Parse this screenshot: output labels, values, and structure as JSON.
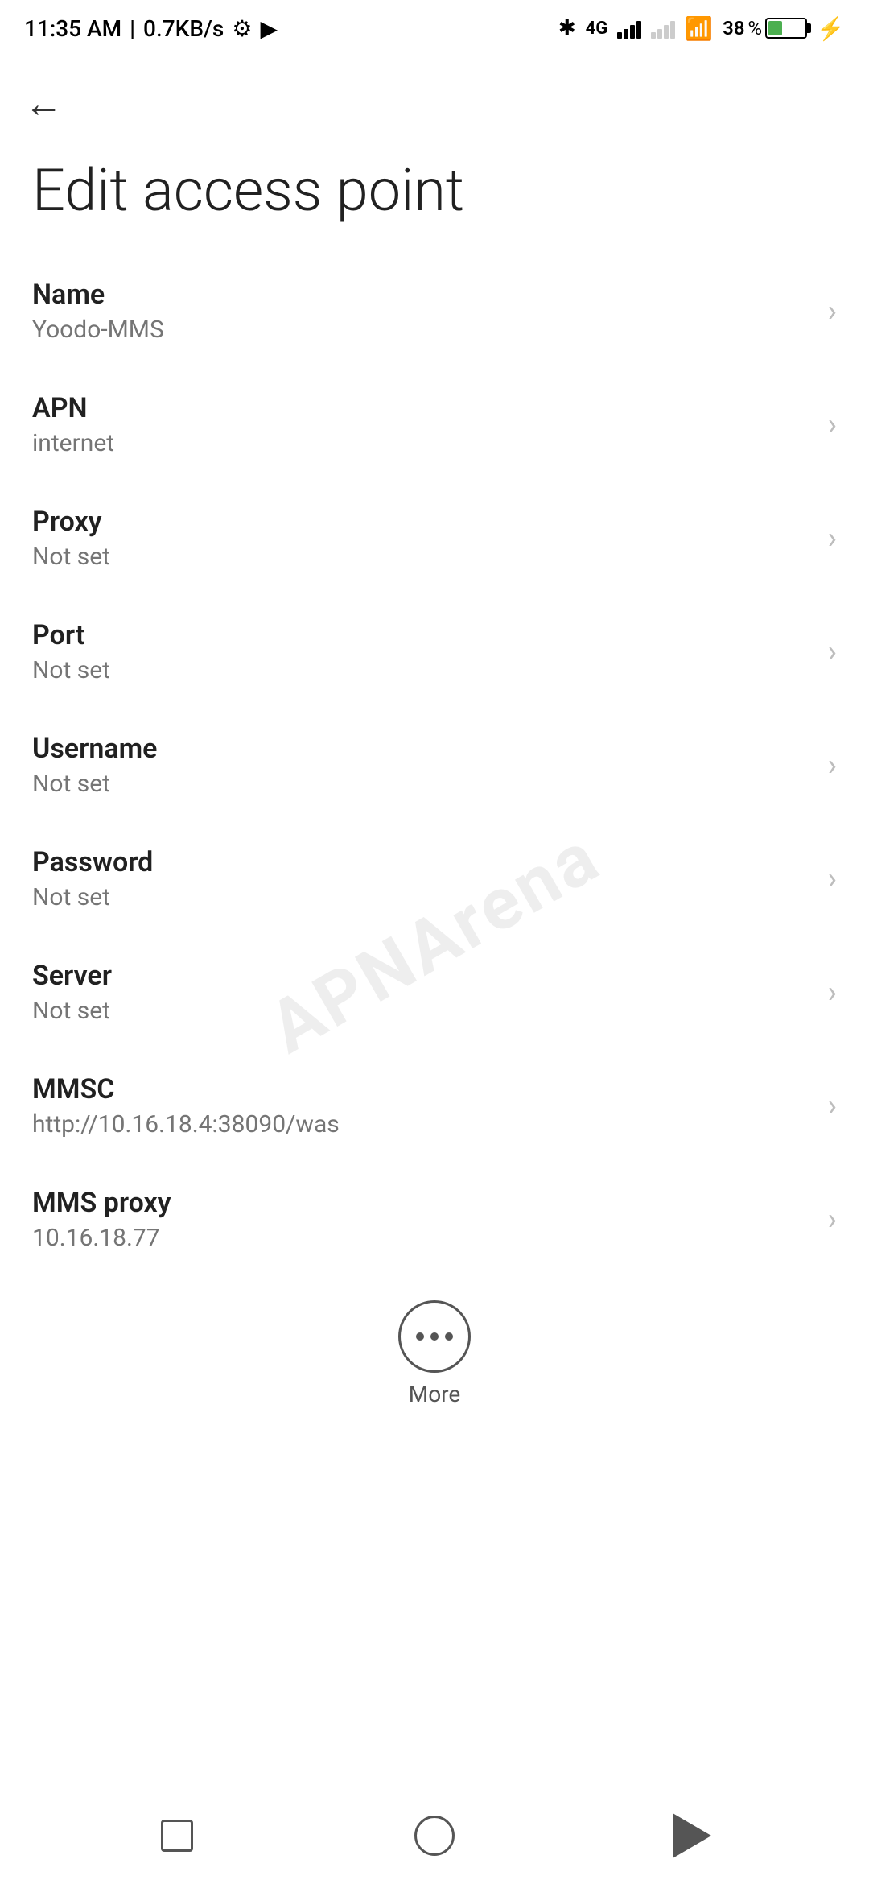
{
  "statusBar": {
    "time": "11:35 AM",
    "speed": "0.7KB/s",
    "battery": 38,
    "batteryColor": "#4CAF50"
  },
  "page": {
    "title": "Edit access point",
    "backLabel": "←"
  },
  "settings": [
    {
      "id": "name",
      "label": "Name",
      "value": "Yoodo-MMS"
    },
    {
      "id": "apn",
      "label": "APN",
      "value": "internet"
    },
    {
      "id": "proxy",
      "label": "Proxy",
      "value": "Not set"
    },
    {
      "id": "port",
      "label": "Port",
      "value": "Not set"
    },
    {
      "id": "username",
      "label": "Username",
      "value": "Not set"
    },
    {
      "id": "password",
      "label": "Password",
      "value": "Not set"
    },
    {
      "id": "server",
      "label": "Server",
      "value": "Not set"
    },
    {
      "id": "mmsc",
      "label": "MMSC",
      "value": "http://10.16.18.4:38090/was"
    },
    {
      "id": "mms-proxy",
      "label": "MMS proxy",
      "value": "10.16.18.77"
    }
  ],
  "more": {
    "label": "More"
  },
  "watermark": "APNArena"
}
